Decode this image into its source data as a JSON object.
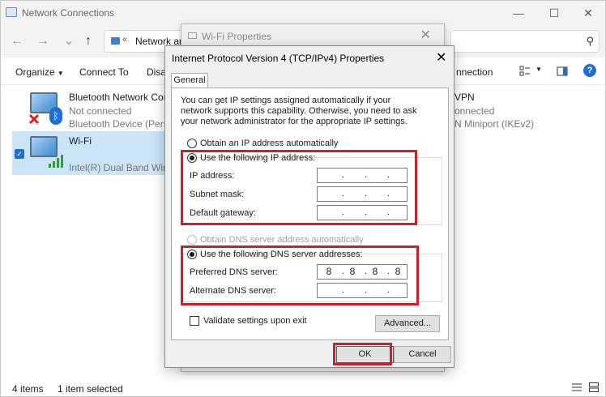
{
  "explorer": {
    "title": "Network Connections",
    "address_crumb_prefix": "«",
    "address_crumb": "Network an",
    "commands": {
      "organize": "Organize",
      "connect_to": "Connect To",
      "disable": "Disab",
      "connection": "nnection"
    },
    "connections": [
      {
        "name": "Bluetooth Network Conn",
        "status": "Not connected",
        "device": "Bluetooth Device (Person",
        "icon": "network-adapter-icon"
      },
      {
        "name": "Wi-Fi",
        "status": "",
        "device": "Intel(R) Dual Band Wirele",
        "icon": "wifi-adapter-icon"
      },
      {
        "name": "VPN",
        "status": "onnected",
        "device": "N Miniport (IKEv2)",
        "icon": "vpn-adapter-icon"
      }
    ],
    "status": {
      "items": "4 items",
      "selected": "1 item selected"
    }
  },
  "wifi_dialog": {
    "title": "Wi-Fi Properties"
  },
  "ipv4_dialog": {
    "title": "Internet Protocol Version 4 (TCP/IPv4) Properties",
    "tab": "General",
    "description": "You can get IP settings assigned automatically if your network supports this capability. Otherwise, you need to ask your network administrator for the appropriate IP settings.",
    "ip_auto_label": "Obtain an IP address automatically",
    "ip_manual_label": "Use the following IP address:",
    "ip_address_label": "IP address:",
    "subnet_mask_label": "Subnet mask:",
    "default_gateway_label": "Default gateway:",
    "dns_auto_label": "Obtain DNS server address automatically",
    "dns_manual_label": "Use the following DNS server addresses:",
    "preferred_dns_label": "Preferred DNS server:",
    "alternate_dns_label": "Alternate DNS server:",
    "preferred_dns": [
      "8",
      "8",
      "8",
      "8"
    ],
    "alternate_dns": [
      "",
      "",
      "",
      ""
    ],
    "ip_address": [
      "",
      "",
      "",
      ""
    ],
    "subnet_mask": [
      "",
      "",
      "",
      ""
    ],
    "default_gateway": [
      "",
      "",
      "",
      ""
    ],
    "validate_label": "Validate settings upon exit",
    "advanced_label": "Advanced...",
    "ok_label": "OK",
    "cancel_label": "Cancel"
  },
  "colors": {
    "highlight_red": "#c9202a",
    "accent_blue": "#1f6fd1"
  }
}
